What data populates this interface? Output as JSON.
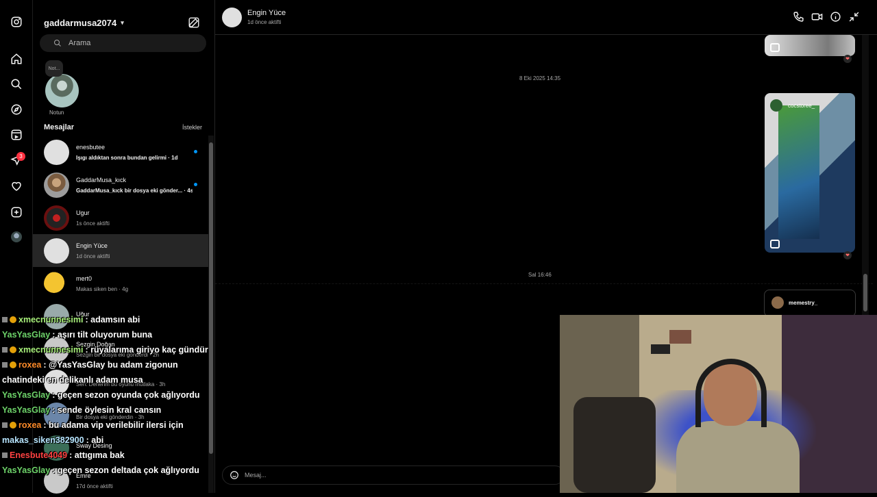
{
  "rail": {
    "icons": [
      "instagram-icon",
      "home-icon",
      "search-icon",
      "explore-icon",
      "reels-icon",
      "messages-icon",
      "notifications-icon",
      "create-icon"
    ],
    "messages_badge": "3"
  },
  "inbox": {
    "username": "gaddarmusa2074",
    "search_placeholder": "Arama",
    "note": {
      "bubble": "Not...",
      "label": "Notun"
    },
    "section_title": "Mesajlar",
    "requests_link": "İstekler",
    "threads": [
      {
        "name": "enesbutee",
        "preview": "Işıgı aldıktan sonra bundan gelirmi · 1d",
        "unread": true
      },
      {
        "name": "GaddarMusa_kıck",
        "preview": "GaddarMusa_kıck bir dosya eki gönder... · 4s",
        "unread": true
      },
      {
        "name": "Ugur",
        "preview": "1s önce aktifti",
        "unread": false
      },
      {
        "name": "Engin Yüce",
        "preview": "1d önce aktifti",
        "unread": false
      },
      {
        "name": "mert0",
        "preview": "Makas siken ben · 4g",
        "unread": false
      },
      {
        "name": "Uğur",
        "preview": "",
        "unread": false
      },
      {
        "name": "Sezgin Doğan",
        "preview": "Sezgin bir dosya eki gönderdi · 2h",
        "unread": false
      },
      {
        "name": "",
        "preview": "Sen: Denerim bu oyunu mutlaka · 3h",
        "unread": false
      },
      {
        "name": "",
        "preview": "Bir dosya eki gönderdin · 3h",
        "unread": false
      },
      {
        "name": "Sway Desing",
        "preview": "",
        "unread": false
      },
      {
        "name": "Emre",
        "preview": "17d önce aktifti",
        "unread": false
      }
    ]
  },
  "chat": {
    "contact_name": "Engin Yüce",
    "contact_status": "1d önce aktifti",
    "timestamp_1": "8 Eki 2025 14:35",
    "timestamp_2": "Sal 16:46",
    "reel_user": "cocstoree_",
    "shared_user": "memestry_",
    "composer_placeholder": "Mesaj...",
    "reaction": "❤"
  },
  "stream_chat": [
    {
      "user": "xmecnunnesimi",
      "msg": ": adamsın abi"
    },
    {
      "user": "YasYasGlay",
      "msg": ": aşırı tilt oluyorum buna"
    },
    {
      "user": "xmecnunnesimi",
      "msg": ": rüyalarıma giriyo kaç gündür"
    },
    {
      "user": "roxea",
      "msg": ": @YasYasGlay bu adam zigonun"
    },
    {
      "user": "",
      "msg": "chatindeki en delikanlı adam musa"
    },
    {
      "user": "YasYasGlay",
      "msg": ": geçen sezon oyunda çok ağlıyordu"
    },
    {
      "user": "YasYasGlay",
      "msg": ": sende öylesin kral cansın"
    },
    {
      "user": "roxea",
      "msg": ": bu adama vip verilebilir ilersi için"
    },
    {
      "user": "makas_siken382900",
      "msg": ": abi"
    },
    {
      "user": "Enesbute4049",
      "msg": ": attıgıma bak"
    },
    {
      "user": "YasYasGlay",
      "msg": ": geçen sezon deltada çok ağlıyordu"
    }
  ]
}
